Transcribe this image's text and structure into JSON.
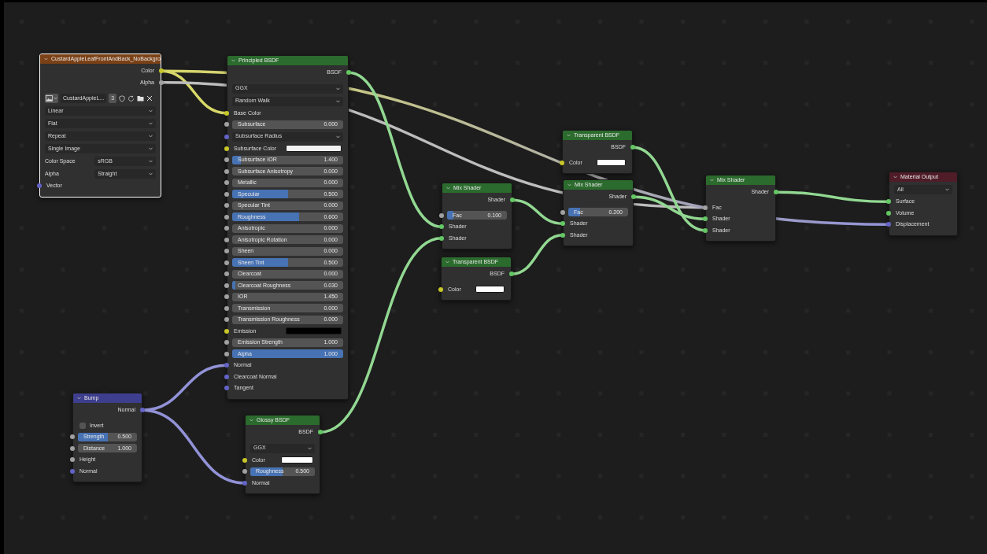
{
  "nodes": [
    {
      "title": "CustardAppleLeafFrontAndBack_NoBackgro",
      "color": "#7b4116",
      "selected": true,
      "rows": [
        {
          "kind": "output",
          "label": "Color",
          "socket": {
            "color": "#c7c729"
          }
        },
        {
          "kind": "output",
          "label": "Alpha",
          "socket": {
            "color": "#a1a1a1"
          }
        },
        {
          "kind": "image",
          "image_name": "CustardAppleL...",
          "users": "3"
        },
        {
          "kind": "dropdown",
          "value": "Linear"
        },
        {
          "kind": "dropdown",
          "value": "Flat"
        },
        {
          "kind": "dropdown",
          "value": "Repeat"
        },
        {
          "kind": "dropdown",
          "value": "Single Image"
        },
        {
          "kind": "field",
          "label": "Color Space",
          "value": "sRGB"
        },
        {
          "kind": "field",
          "label": "Alpha",
          "value": "Straight"
        },
        {
          "kind": "input",
          "label": "Vector",
          "socket": {
            "color": "#6363c7"
          }
        }
      ]
    },
    {
      "title": "Principled BSDF",
      "color": "#2b6b2d",
      "selected": false,
      "rows": [
        {
          "kind": "output",
          "label": "BSDF",
          "socket": {
            "color": "#63c763"
          }
        },
        {
          "kind": "dropdown",
          "value": "GGX"
        },
        {
          "kind": "dropdown",
          "value": "Random Walk"
        },
        {
          "kind": "input",
          "label": "Base Color",
          "socket": {
            "color": "#c7c729"
          }
        },
        {
          "kind": "value",
          "label": "Subsurface",
          "value": "0.000",
          "level": 0,
          "socket": {
            "color": "#a1a1a1"
          }
        },
        {
          "kind": "dropdown",
          "value": "Subsurface Radius",
          "socket": {
            "color": "#6363c7"
          }
        },
        {
          "kind": "color",
          "label": "Subsurface Color",
          "color": "#f2f2f2",
          "socket": {
            "color": "#c7c729"
          }
        },
        {
          "kind": "value",
          "label": "Subsurface IOR",
          "value": "1.400",
          "level": 0.08,
          "socket": {
            "color": "#a1a1a1"
          }
        },
        {
          "kind": "value",
          "label": "Subsurface Anisotropy",
          "value": "0.000",
          "level": 0,
          "socket": {
            "color": "#a1a1a1"
          }
        },
        {
          "kind": "value",
          "label": "Metallic",
          "value": "0.000",
          "level": 0,
          "socket": {
            "color": "#a1a1a1"
          }
        },
        {
          "kind": "value",
          "label": "Specular",
          "value": "0.500",
          "level": 0.5,
          "socket": {
            "color": "#a1a1a1"
          }
        },
        {
          "kind": "value",
          "label": "Specular Tint",
          "value": "0.000",
          "level": 0,
          "socket": {
            "color": "#a1a1a1"
          }
        },
        {
          "kind": "value",
          "label": "Roughness",
          "value": "0.600",
          "level": 0.6,
          "socket": {
            "color": "#a1a1a1"
          }
        },
        {
          "kind": "value",
          "label": "Anisotropic",
          "value": "0.000",
          "level": 0,
          "socket": {
            "color": "#a1a1a1"
          }
        },
        {
          "kind": "value",
          "label": "Anisotropic Rotation",
          "value": "0.000",
          "level": 0,
          "socket": {
            "color": "#a1a1a1"
          }
        },
        {
          "kind": "value",
          "label": "Sheen",
          "value": "0.000",
          "level": 0,
          "socket": {
            "color": "#a1a1a1"
          }
        },
        {
          "kind": "value",
          "label": "Sheen Tint",
          "value": "0.500",
          "level": 0.5,
          "socket": {
            "color": "#a1a1a1"
          }
        },
        {
          "kind": "value",
          "label": "Clearcoat",
          "value": "0.000",
          "level": 0,
          "socket": {
            "color": "#a1a1a1"
          }
        },
        {
          "kind": "value",
          "label": "Clearcoat Roughness",
          "value": "0.030",
          "level": 0.03,
          "socket": {
            "color": "#a1a1a1"
          }
        },
        {
          "kind": "value",
          "label": "IOR",
          "value": "1.450",
          "level": 0,
          "socket": {
            "color": "#a1a1a1"
          }
        },
        {
          "kind": "value",
          "label": "Transmission",
          "value": "0.000",
          "level": 0,
          "socket": {
            "color": "#a1a1a1"
          }
        },
        {
          "kind": "value",
          "label": "Transmission Roughness",
          "value": "0.000",
          "level": 0,
          "socket": {
            "color": "#a1a1a1"
          }
        },
        {
          "kind": "color",
          "label": "Emission",
          "color": "#000000",
          "socket": {
            "color": "#c7c729"
          }
        },
        {
          "kind": "value",
          "label": "Emission Strength",
          "value": "1.000",
          "level": 0,
          "socket": {
            "color": "#a1a1a1"
          }
        },
        {
          "kind": "value",
          "label": "Alpha",
          "value": "1.000",
          "level": 1,
          "socket": {
            "color": "#a1a1a1"
          }
        },
        {
          "kind": "input",
          "label": "Normal",
          "socket": {
            "color": "#6363c7"
          }
        },
        {
          "kind": "input",
          "label": "Clearcoat Normal",
          "socket": {
            "color": "#6363c7"
          }
        },
        {
          "kind": "input",
          "label": "Tangent",
          "socket": {
            "color": "#6363c7"
          }
        }
      ]
    },
    {
      "title": "Mix Shader",
      "color": "#2b6b2d",
      "selected": false,
      "rows": [
        {
          "kind": "output",
          "label": "Shader",
          "socket": {
            "color": "#63c763"
          }
        },
        {
          "kind": "value",
          "label": "Fac",
          "value": "0.100",
          "level": 0.1,
          "socket": {
            "color": "#a1a1a1"
          }
        },
        {
          "kind": "input",
          "label": "Shader",
          "socket": {
            "color": "#63c763"
          }
        },
        {
          "kind": "input",
          "label": "Shader",
          "socket": {
            "color": "#63c763"
          }
        }
      ]
    },
    {
      "title": "Transparent BSDF",
      "color": "#2b6b2d",
      "selected": false,
      "rows": [
        {
          "kind": "output",
          "label": "BSDF",
          "socket": {
            "color": "#63c763"
          }
        },
        {
          "kind": "color",
          "label": "Color",
          "color": "#ffffff",
          "socket": {
            "color": "#c7c729"
          }
        }
      ]
    },
    {
      "title": "Transparent BSDF",
      "color": "#2b6b2d",
      "selected": false,
      "rows": [
        {
          "kind": "output",
          "label": "BSDF",
          "socket": {
            "color": "#63c763"
          }
        },
        {
          "kind": "color",
          "label": "Color",
          "color": "#ffffff",
          "socket": {
            "color": "#c7c729"
          }
        }
      ]
    },
    {
      "title": "Mix Shader",
      "color": "#2b6b2d",
      "selected": false,
      "rows": [
        {
          "kind": "output",
          "label": "Shader",
          "socket": {
            "color": "#63c763"
          }
        },
        {
          "kind": "value",
          "label": "Fac",
          "value": "0.200",
          "level": 0.2,
          "socket": {
            "color": "#a1a1a1"
          }
        },
        {
          "kind": "input",
          "label": "Shader",
          "socket": {
            "color": "#63c763"
          }
        },
        {
          "kind": "input",
          "label": "Shader",
          "socket": {
            "color": "#63c763"
          }
        }
      ]
    },
    {
      "title": "Mix Shader",
      "color": "#2b6b2d",
      "selected": false,
      "rows": [
        {
          "kind": "output",
          "label": "Shader",
          "socket": {
            "color": "#63c763"
          }
        },
        {
          "kind": "input",
          "label": "Fac",
          "socket": {
            "color": "#a1a1a1"
          }
        },
        {
          "kind": "input",
          "label": "Shader",
          "socket": {
            "color": "#63c763"
          }
        },
        {
          "kind": "input",
          "label": "Shader",
          "socket": {
            "color": "#63c763"
          }
        }
      ]
    },
    {
      "title": "Material Output",
      "color": "#4f1c28",
      "selected": false,
      "rows": [
        {
          "kind": "dropdown",
          "value": "All"
        },
        {
          "kind": "input",
          "label": "Surface",
          "socket": {
            "color": "#63c763"
          }
        },
        {
          "kind": "input",
          "label": "Volume",
          "socket": {
            "color": "#63c763"
          }
        },
        {
          "kind": "input",
          "label": "Displacement",
          "socket": {
            "color": "#6363c7"
          }
        }
      ]
    },
    {
      "title": "Bump",
      "color": "#3e3e8e",
      "selected": false,
      "rows": [
        {
          "kind": "output",
          "label": "Normal",
          "socket": {
            "color": "#6363c7"
          }
        },
        {
          "kind": "checkbox",
          "label": "Invert",
          "checked": false
        },
        {
          "kind": "value",
          "label": "Strength",
          "value": "0.500",
          "level": 0.5,
          "socket": {
            "color": "#a1a1a1"
          }
        },
        {
          "kind": "value",
          "label": "Distance",
          "value": "1.000",
          "level": 0,
          "socket": {
            "color": "#a1a1a1"
          }
        },
        {
          "kind": "input",
          "label": "Height",
          "socket": {
            "color": "#a1a1a1"
          }
        },
        {
          "kind": "input",
          "label": "Normal",
          "socket": {
            "color": "#6363c7"
          }
        }
      ]
    },
    {
      "title": "Glossy BSDF",
      "color": "#2b6b2d",
      "selected": false,
      "rows": [
        {
          "kind": "output",
          "label": "BSDF",
          "socket": {
            "color": "#63c763"
          }
        },
        {
          "kind": "dropdown",
          "value": "GGX"
        },
        {
          "kind": "color",
          "label": "Color",
          "color": "#ffffff",
          "socket": {
            "color": "#c7c729"
          }
        },
        {
          "kind": "value",
          "label": "Roughness",
          "value": "0.500",
          "level": 0.5,
          "socket": {
            "color": "#a1a1a1"
          }
        },
        {
          "kind": "input",
          "label": "Normal",
          "socket": {
            "color": "#6363c7"
          }
        }
      ]
    }
  ]
}
